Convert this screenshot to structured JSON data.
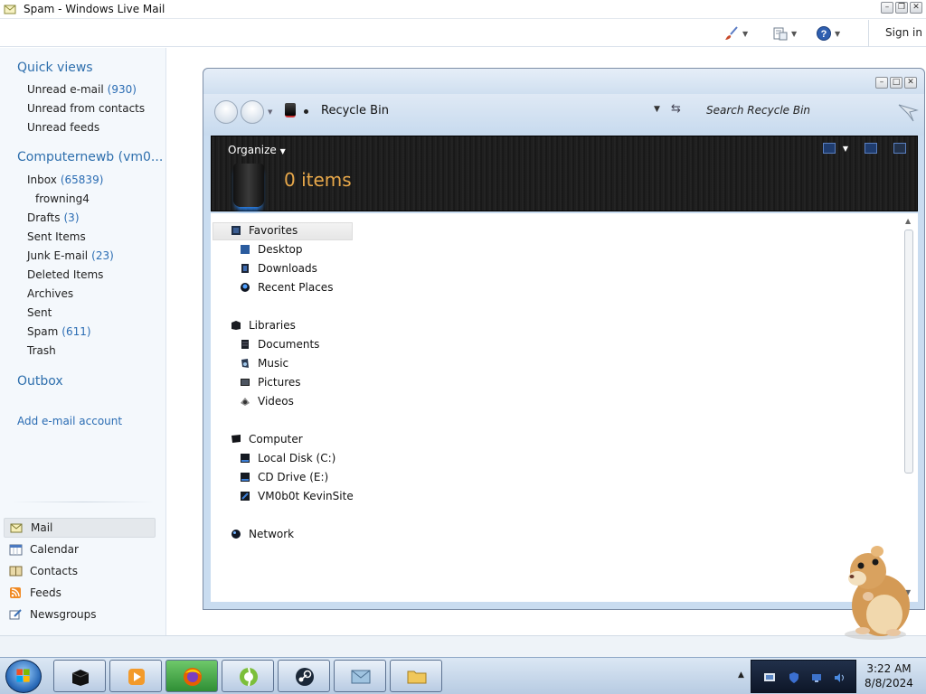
{
  "window": {
    "title": "Spam - Windows Live Mail"
  },
  "toolbar": {
    "sign_in": "Sign in",
    "icons": [
      "paintbrush-icon",
      "layout-icon",
      "help-icon"
    ]
  },
  "nav": {
    "quick_views": {
      "heading": "Quick views",
      "items": [
        {
          "label": "Unread e-mail",
          "count": "(930)"
        },
        {
          "label": "Unread from contacts",
          "count": ""
        },
        {
          "label": "Unread feeds",
          "count": ""
        }
      ]
    },
    "account": {
      "heading": "Computernewb (vm0...",
      "items": [
        {
          "label": "Inbox",
          "count": "(65839)"
        },
        {
          "label": "frowning4",
          "count": ""
        },
        {
          "label": "Drafts",
          "count": "(3)"
        },
        {
          "label": "Sent Items",
          "count": ""
        },
        {
          "label": "Junk E-mail",
          "count": "(23)"
        },
        {
          "label": "Deleted Items",
          "count": ""
        },
        {
          "label": "Archives",
          "count": ""
        },
        {
          "label": "Sent",
          "count": ""
        },
        {
          "label": "Spam",
          "count": "(611)"
        },
        {
          "label": "Trash",
          "count": ""
        }
      ]
    },
    "outbox": "Outbox",
    "add_account": "Add e-mail account",
    "modes": [
      "Mail",
      "Calendar",
      "Contacts",
      "Feeds",
      "Newsgroups"
    ]
  },
  "explorer": {
    "address": "Recycle Bin",
    "search_placeholder": "Search Recycle Bin",
    "organize": "Organize",
    "item_count": "0 items",
    "tree": {
      "favorites": {
        "label": "Favorites",
        "children": [
          "Desktop",
          "Downloads",
          "Recent Places"
        ]
      },
      "libraries": {
        "label": "Libraries",
        "children": [
          "Documents",
          "Music",
          "Pictures",
          "Videos"
        ]
      },
      "computer": {
        "label": "Computer",
        "children": [
          "Local Disk (C:)",
          "CD Drive (E:)",
          "VM0b0t KevinSite"
        ]
      },
      "network": {
        "label": "Network"
      }
    }
  },
  "taskbar": {
    "apps": [
      "explorer-icon",
      "media-player-icon",
      "firefox-icon",
      "ccleaner-icon",
      "steam-icon",
      "windows-live-mail-icon",
      "folder-icon"
    ],
    "clock": {
      "time": "3:22 AM",
      "date": "8/8/2024"
    }
  },
  "colors": {
    "accent": "#2e6fad",
    "link": "#2a6cb3",
    "count": "#2a6cb3",
    "items_orange": "#e8a84a"
  }
}
